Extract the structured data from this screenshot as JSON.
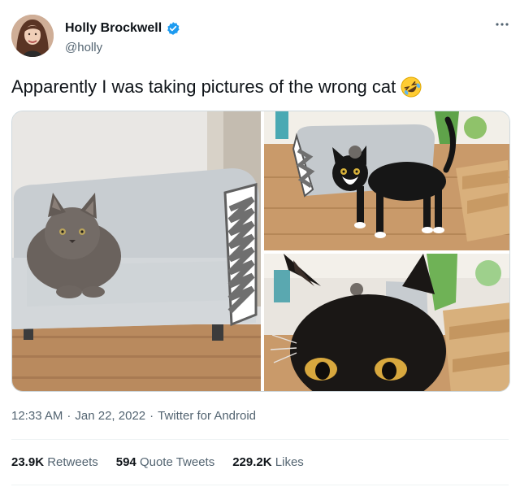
{
  "author": {
    "name": "Holly Brockwell",
    "handle": "@holly",
    "verified_icon": "verified-badge-icon",
    "avatar_icon": "avatar"
  },
  "more_icon": "more-icon",
  "tweet": {
    "text": "Apparently I was taking pictures of the wrong cat",
    "emoji": "rolling-on-floor-laughing-emoji"
  },
  "media": {
    "images": [
      "grey-cat-on-sofa-photo",
      "tuxedo-cat-standing-photo",
      "black-cat-closeup-photo"
    ]
  },
  "meta": {
    "time": "12:33 AM",
    "separator": "·",
    "date": "Jan 22, 2022",
    "source": "Twitter for Android"
  },
  "stats": {
    "retweets_count": "23.9K",
    "retweets_label": "Retweets",
    "quotes_count": "594",
    "quotes_label": "Quote Tweets",
    "likes_count": "229.2K",
    "likes_label": "Likes"
  },
  "colors": {
    "text": "#0f1419",
    "secondary": "#536471",
    "verified": "#1d9bf0",
    "divider": "#eff3f4"
  }
}
